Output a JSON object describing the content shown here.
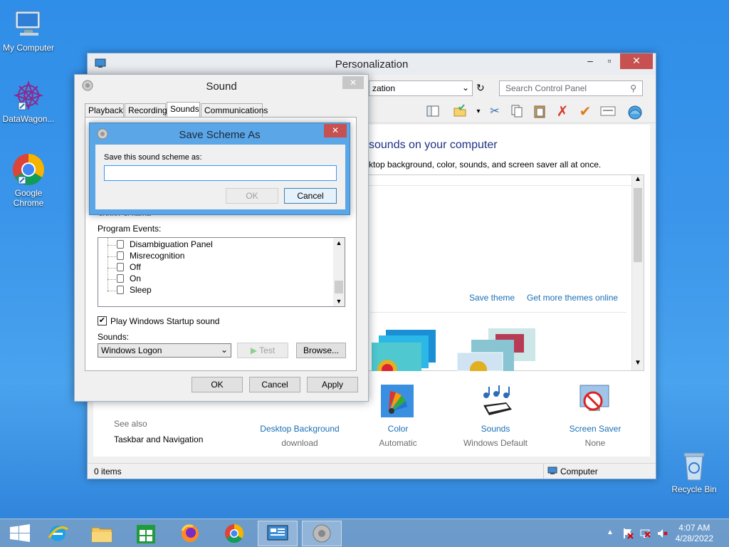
{
  "desktop": {
    "icons": [
      {
        "label": "My Computer"
      },
      {
        "label": "DataWagon..."
      },
      {
        "label": "Google Chrome"
      },
      {
        "label": "Recycle Bin"
      }
    ]
  },
  "personalization": {
    "title": "Personalization",
    "address": "zation",
    "search_placeholder": "Search Control Panel",
    "heading": "sounds on your computer",
    "subheading": "ktop background, color, sounds, and screen saver all at once.",
    "save_theme": "Save theme",
    "get_more_themes": "Get more themes online",
    "see_also": "See also",
    "taskbar_nav": "Taskbar and Navigation",
    "bottom_items": [
      {
        "label": "Desktop Background",
        "sub": "download"
      },
      {
        "label": "Color",
        "sub": "Automatic"
      },
      {
        "label": "Sounds",
        "sub": "Windows Default"
      },
      {
        "label": "Screen Saver",
        "sub": "None"
      }
    ],
    "status_left": "0 items",
    "status_right": "Computer"
  },
  "sound_dialog": {
    "title": "Sound",
    "tabs": [
      "Playback",
      "Recording",
      "Sounds",
      "Communications"
    ],
    "active_tab": "Sounds",
    "scheme_label_partial": "Sound Scheme:",
    "program_events_label": "Program Events:",
    "events": [
      "Disambiguation Panel",
      "Misrecognition",
      "Off",
      "On",
      "Sleep"
    ],
    "startup_checkbox": "Play Windows Startup sound",
    "sounds_label": "Sounds:",
    "sounds_value": "Windows Logon",
    "test_button": "Test",
    "browse_button": "Browse...",
    "ok": "OK",
    "cancel": "Cancel",
    "apply": "Apply"
  },
  "save_dialog": {
    "title": "Save Scheme As",
    "prompt": "Save this sound scheme as:",
    "value": "",
    "ok": "OK",
    "cancel": "Cancel"
  },
  "taskbar": {
    "time": "4:07 AM",
    "date": "4/28/2022"
  }
}
